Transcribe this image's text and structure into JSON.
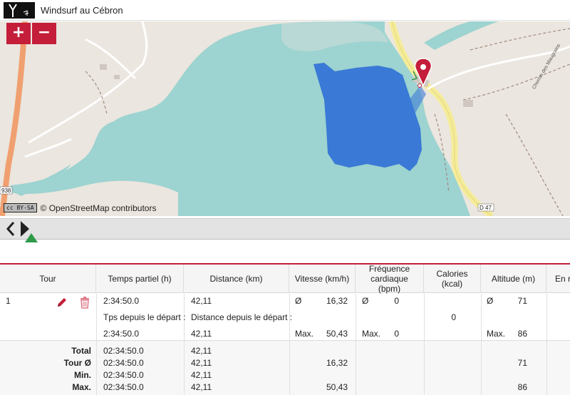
{
  "header": {
    "title": "Windsurf au Cébron",
    "logo_icon": "windsurf-logo-icon"
  },
  "map": {
    "zoom_in_label": "+",
    "zoom_out_label": "−",
    "attribution": "© OpenStreetMap contributors",
    "license_badge": "cc BY-SA",
    "road_labels": {
      "left": "938",
      "right": "D 47",
      "street": "Chemin des Maugrains"
    },
    "colors": {
      "water": "#9dd3d0",
      "land": "#ebe6df",
      "track": "#3a79d6",
      "marker": "#c41e3a",
      "main_road": "#f0a070",
      "secondary_road": "#f5ec9a"
    }
  },
  "timeline": {
    "prev_icon": "chevron-left-icon",
    "next_icon": "chevron-right-icon",
    "marker_icon": "position-marker-icon"
  },
  "table": {
    "headers": {
      "tour": "Tour",
      "temps": "Temps partiel (h)",
      "distance": "Distance (km)",
      "vitesse": "Vitesse (km/h)",
      "frequence": "Fréquence cardiaque (bpm)",
      "calories": "Calories (kcal)",
      "altitude": "Altitude (m)",
      "more": "En r"
    },
    "lap": {
      "number": "1",
      "temps_partiel": "2:34:50.0",
      "tps_label": "Tps depuis le départ :",
      "tps_value": "2:34:50.0",
      "distance": "42,11",
      "distance_label": "Distance depuis le départ :",
      "distance_cumul": "42,11",
      "avg_symbol": "Ø",
      "max_label": "Max.",
      "vitesse_avg": "16,32",
      "vitesse_max": "50,43",
      "fc_avg": "0",
      "fc_max": "0",
      "calories": "0",
      "altitude_avg": "71",
      "altitude_max": "86"
    },
    "summary": {
      "labels": [
        "Total",
        "Tour Ø",
        "Min.",
        "Max."
      ],
      "temps": [
        "02:34:50.0",
        "02:34:50.0",
        "02:34:50.0",
        "02:34:50.0"
      ],
      "distance": [
        "42,11",
        "42,11",
        "42,11",
        "42,11"
      ],
      "vitesse": [
        "",
        "16,32",
        "",
        "50,43"
      ],
      "altitude": [
        "",
        "71",
        "",
        "86"
      ]
    }
  }
}
